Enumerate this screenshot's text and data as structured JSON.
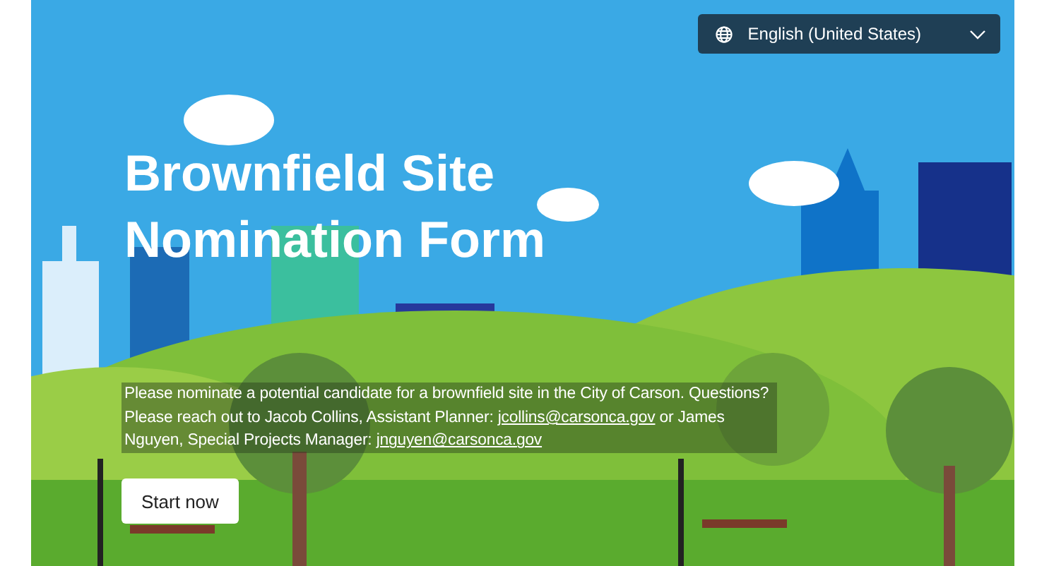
{
  "language_selector": {
    "label": "English (United States)"
  },
  "form": {
    "title": "Brownfield Site Nomination Form",
    "description": [
      {
        "kind": "text",
        "text": "Please nominate a potential candidate for a brownfield site in the City of Carson. Questions? Please reach out to Jacob Collins, Assistant Planner: "
      },
      {
        "kind": "link",
        "text": "jcollins@carsonca.gov"
      },
      {
        "kind": "text",
        "text": " or James Nguyen, Special Projects Manager: "
      },
      {
        "kind": "link",
        "text": "jnguyen@carsonca.gov"
      }
    ],
    "start_button": "Start now"
  }
}
